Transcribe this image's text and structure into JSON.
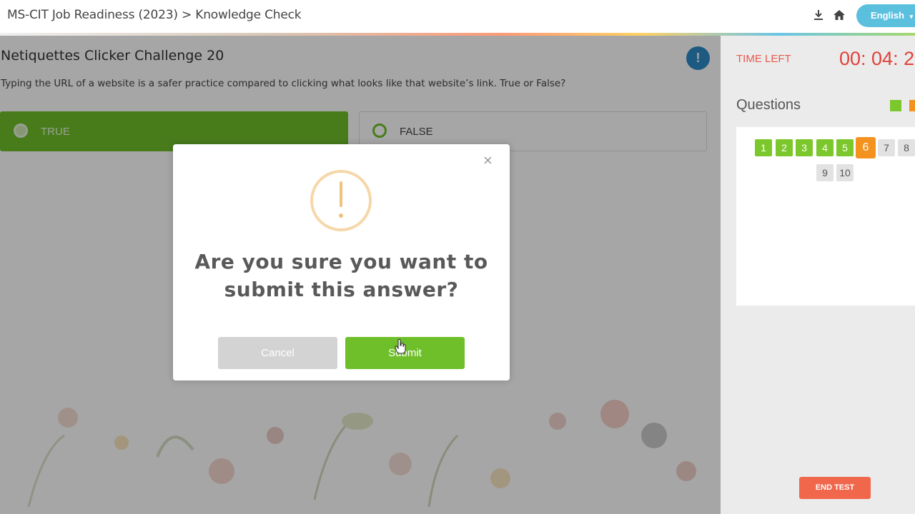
{
  "header": {
    "breadcrumb": "MS-CIT Job Readiness (2023) > Knowledge Check",
    "language": "English",
    "icons": [
      "download-icon",
      "home-icon",
      "chevron-down-icon"
    ]
  },
  "question": {
    "title": "Netiquettes Clicker Challenge 20",
    "text": "Typing the URL of a website is a safer practice compared to clicking what looks like that website’s link. True or False?",
    "info_label": "!",
    "options": [
      {
        "label": "TRUE",
        "selected": true
      },
      {
        "label": "FALSE",
        "selected": false
      }
    ]
  },
  "sidebar": {
    "time_label": "TIME LEFT",
    "time_value": "00: 04: 2",
    "questions_heading": "Questions",
    "legend_colors": [
      "#7cc82c",
      "#f3921e"
    ],
    "question_numbers": [
      {
        "n": "1",
        "status": "done"
      },
      {
        "n": "2",
        "status": "done"
      },
      {
        "n": "3",
        "status": "done"
      },
      {
        "n": "4",
        "status": "done"
      },
      {
        "n": "5",
        "status": "done"
      },
      {
        "n": "6",
        "status": "current"
      },
      {
        "n": "7",
        "status": "pending"
      },
      {
        "n": "8",
        "status": "pending"
      },
      {
        "n": "9",
        "status": "pending"
      },
      {
        "n": "10",
        "status": "pending"
      }
    ],
    "end_test": "END TEST"
  },
  "modal": {
    "close": "×",
    "message_line1": "Are you sure you want to",
    "message_line2": "submit this answer?",
    "cancel": "Cancel",
    "submit": "Submit",
    "accent_color": "#f0c27b"
  }
}
